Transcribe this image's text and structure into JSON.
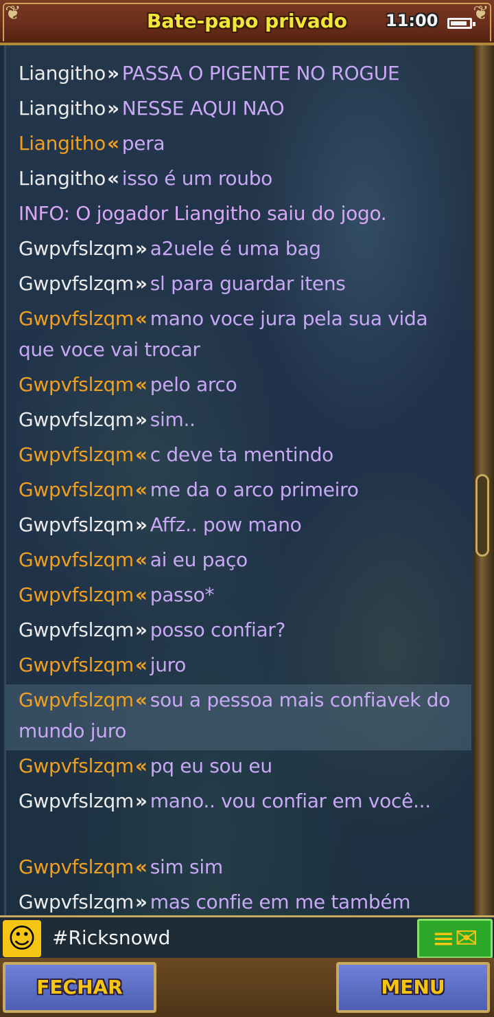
{
  "header": {
    "title": "Bate-papo privado",
    "clock": "11:00",
    "battery_level_pct": 90
  },
  "messages": [
    {
      "sender": "Liangitho",
      "dir": "in",
      "arrow": "»",
      "text": "PASSA O PIGENTE NO ROGUE"
    },
    {
      "sender": "Liangitho",
      "dir": "in",
      "arrow": "»",
      "text": "NESSE AQUI NAO"
    },
    {
      "sender": "Liangitho",
      "dir": "out",
      "arrow": "«",
      "text": "pera"
    },
    {
      "sender": "Liangitho",
      "dir": "in-gray",
      "arrow": "«",
      "text": "isso é um roubo"
    },
    {
      "info": "INFO: O jogador Liangitho saiu do jogo."
    },
    {
      "sender": "Gwpvfslzqm",
      "dir": "in",
      "arrow": "»",
      "text": "a2uele é uma bag"
    },
    {
      "sender": "Gwpvfslzqm",
      "dir": "in",
      "arrow": "»",
      "text": "sl para guardar itens"
    },
    {
      "sender": "Gwpvfslzqm",
      "dir": "out",
      "arrow": "«",
      "text": "mano voce jura pela sua vida que voce vai trocar",
      "wrap": true
    },
    {
      "sender": "Gwpvfslzqm",
      "dir": "out",
      "arrow": "«",
      "text": "pelo arco"
    },
    {
      "sender": "Gwpvfslzqm",
      "dir": "in",
      "arrow": "»",
      "text": "sim.."
    },
    {
      "sender": "Gwpvfslzqm",
      "dir": "out",
      "arrow": "«",
      "text": "c deve ta mentindo"
    },
    {
      "sender": "Gwpvfslzqm",
      "dir": "out",
      "arrow": "«",
      "text": "me da o arco primeiro"
    },
    {
      "sender": "Gwpvfslzqm",
      "dir": "in",
      "arrow": "»",
      "text": "Affz.. pow mano"
    },
    {
      "sender": "Gwpvfslzqm",
      "dir": "out",
      "arrow": "«",
      "text": "ai eu paço"
    },
    {
      "sender": "Gwpvfslzqm",
      "dir": "out",
      "arrow": "«",
      "text": "passo*"
    },
    {
      "sender": "Gwpvfslzqm",
      "dir": "in",
      "arrow": "»",
      "text": "posso confiar?"
    },
    {
      "sender": "Gwpvfslzqm",
      "dir": "out",
      "arrow": "«",
      "text": "juro"
    },
    {
      "sender": "Gwpvfslzqm",
      "dir": "out",
      "arrow": "«",
      "text": "sou a pessoa mais confiavek do mundo juro",
      "wrap": true,
      "highlight": true
    },
    {
      "sender": "Gwpvfslzqm",
      "dir": "out",
      "arrow": "«",
      "text": "pq eu sou eu"
    },
    {
      "sender": "Gwpvfslzqm",
      "dir": "in",
      "arrow": "»",
      "text": "mano.. vou confiar em você...",
      "wrap": true
    },
    {
      "sender": "Gwpvfslzqm",
      "dir": "out",
      "arrow": "«",
      "text": "sim sim"
    },
    {
      "sender": "Gwpvfslzqm",
      "dir": "in",
      "arrow": "»",
      "text": "mas confie em me também"
    }
  ],
  "input": {
    "value": "#Ricksnowd",
    "smiley_icon": "smiley-face-icon",
    "send_icon": "send-mail-icon"
  },
  "buttons": {
    "close": "FECHAR",
    "menu": "MENU"
  },
  "colors": {
    "outgoing_name": "#f0a020",
    "incoming_name": "#ececec",
    "message_text": "#c9a8f5",
    "title": "#f2e63a",
    "button_text": "#f6c514"
  }
}
